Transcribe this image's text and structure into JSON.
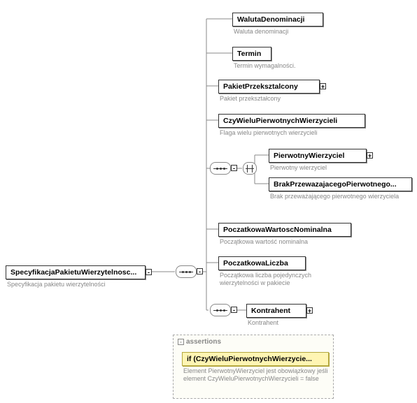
{
  "root": {
    "label": "SpecyfikacjaPakietuWierzytelnosc...",
    "caption": "Specyfikacja pakietu wierzytelności"
  },
  "children": {
    "walutaDenominacji": {
      "label": "WalutaDenominacji",
      "caption": "Waluta denominacji"
    },
    "termin": {
      "label": "Termin",
      "caption": "Termin wymagalności."
    },
    "pakietPrzeksztalcony": {
      "label": "PakietPrzeksztalcony",
      "caption": "Pakiet przekształcony"
    },
    "czyWielu": {
      "label": "CzyWieluPierwotnychWierzycieli",
      "caption": "Flaga wielu pierwotnych wierzycieli"
    },
    "choiceA": {
      "label": "PierwotnyWierzyciel",
      "caption": "Pierwotny wierzyciel"
    },
    "choiceB": {
      "label": "BrakPrzewazajacegoPierwotnego...",
      "caption": "Brak przeważającego pierwotnego wierzyciela"
    },
    "poczWartosc": {
      "label": "PoczatkowaWartoscNominalna",
      "caption": "Początkowa wartość nominalna"
    },
    "poczLiczba": {
      "label": "PoczatkowaLiczba",
      "caption": "Początkowa liczba pojedynczych wierzytelności w pakiecie"
    },
    "kontrahent": {
      "label": "Kontrahent",
      "caption": "Kontrahent"
    }
  },
  "assertions": {
    "title": "assertions",
    "if": {
      "label": "if (CzyWieluPierwotnychWierzycie...",
      "caption": "Element PierwotnyWierzyciel jest obowiązkowy jeśli element CzyWieluPierwotnychWierzycieli = false"
    }
  }
}
